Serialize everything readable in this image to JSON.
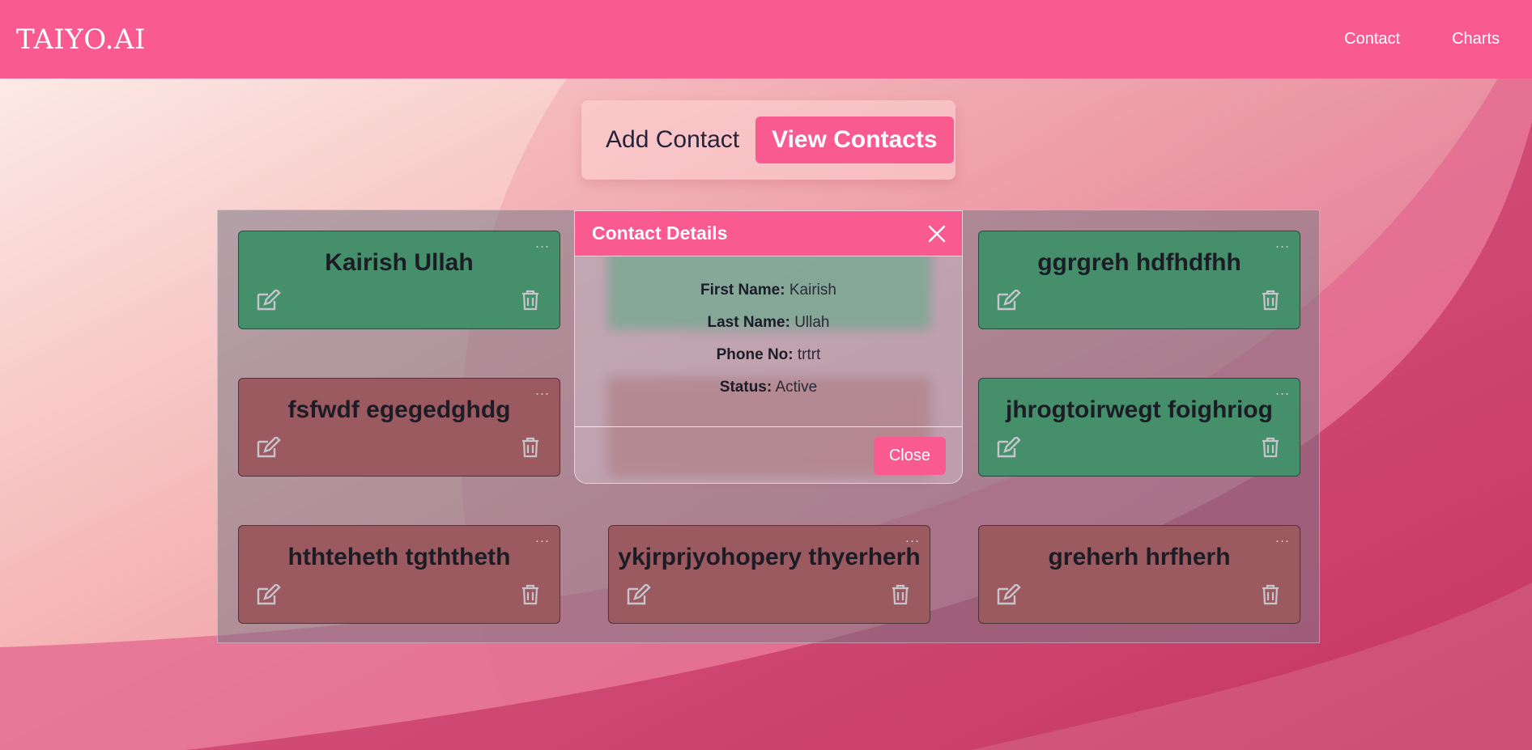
{
  "navbar": {
    "brand": "TAIYO.AI",
    "links": [
      "Contact",
      "Charts"
    ]
  },
  "toggle": {
    "add_label": "Add Contact",
    "view_label": "View Contacts"
  },
  "contacts": [
    {
      "name": "Kairish Ullah",
      "status": "active"
    },
    {
      "name": "",
      "status": "active"
    },
    {
      "name": "ggrgreh hdfhdfhh",
      "status": "active"
    },
    {
      "name": "fsfwdf egegedghdg",
      "status": "inactive"
    },
    {
      "name": "",
      "status": "inactive"
    },
    {
      "name": "jhrogtoirwegt foighriog",
      "status": "active"
    },
    {
      "name": "hthteheth tgththeth",
      "status": "inactive"
    },
    {
      "name": "ykjrprjyohopery thyerherh",
      "status": "inactive"
    },
    {
      "name": "greherh hrfherh",
      "status": "inactive"
    }
  ],
  "card_more_label": "...",
  "modal": {
    "title": "Contact Details",
    "fields": [
      {
        "label": "First Name:",
        "value": "Kairish"
      },
      {
        "label": "Last Name:",
        "value": "Ullah"
      },
      {
        "label": "Phone No:",
        "value": "trtrt"
      },
      {
        "label": "Status:",
        "value": "Active"
      }
    ],
    "close_label": "Close"
  },
  "colors": {
    "accent": "#f95b91",
    "active_card": "#45906b",
    "inactive_card": "#9b5a5f"
  }
}
